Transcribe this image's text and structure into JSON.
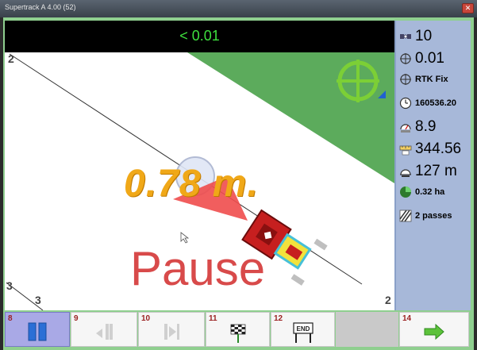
{
  "window": {
    "title": "Supertrack A 4.00 (52)",
    "close_symbol": "✕"
  },
  "guidance": {
    "cross_track_error": "< 0.01"
  },
  "map": {
    "offset_text": "0.78 m.",
    "status_text": "Pause",
    "pass_labels": {
      "top_left": "2",
      "bottom_left_a": "3",
      "bottom_left_b": "3",
      "bottom_right": "2"
    },
    "colors": {
      "field": "#ffffff",
      "worked_area": "#5cab5c",
      "vehicle_body": "#c61f1f",
      "vehicle_cab": "#f2e23c",
      "direction_arrow": "#f04c4c"
    }
  },
  "status_panel": {
    "satellites": "10",
    "accuracy": "0.01",
    "fix_type": "RTK Fix",
    "time": "160536.20",
    "speed": "8.9",
    "heading": "344.56",
    "width": "127 m",
    "area": "0.32 ha",
    "passes": "2 passes",
    "icons": [
      "satellite-icon",
      "crosshair-icon",
      "crosshair-icon",
      "clock-icon",
      "speedometer-icon",
      "ruler-icon",
      "implement-icon",
      "area-icon",
      "passes-icon"
    ]
  },
  "toolbar": {
    "buttons": [
      {
        "num": "8",
        "icon": "pause-icon",
        "state": "active"
      },
      {
        "num": "9",
        "icon": "left-turn-icon",
        "state": "disabled"
      },
      {
        "num": "10",
        "icon": "right-turn-icon",
        "state": "disabled"
      },
      {
        "num": "11",
        "icon": "start-flag-icon",
        "state": "normal"
      },
      {
        "num": "12",
        "icon": "end-flag-icon",
        "state": "normal",
        "label": "END"
      },
      {
        "num": "14",
        "icon": "next-arrow-icon",
        "state": "normal"
      }
    ]
  }
}
